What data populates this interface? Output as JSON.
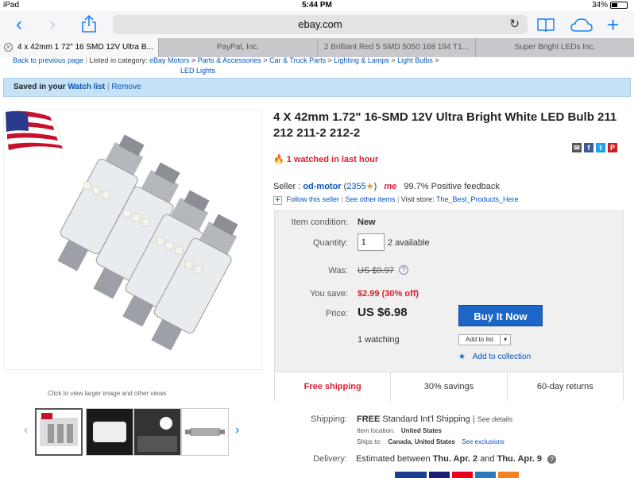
{
  "status_bar": {
    "device": "iPad",
    "time": "5:44 PM",
    "battery": "34%"
  },
  "toolbar": {
    "url": "ebay.com"
  },
  "tabs": [
    {
      "label": "4 x 42mm 1 72\" 16 SMD 12V Ultra B..."
    },
    {
      "label": "PayPal, Inc."
    },
    {
      "label": "2 Brilliant Red 5 SMD 5050 168 194 T1..."
    },
    {
      "label": "Super Bright LEDs Inc."
    }
  ],
  "breadcrumb": {
    "back": "Back to previous page",
    "listed_in": "Listed in category:",
    "items": [
      "eBay Motors",
      "Parts & Accessories",
      "Car & Truck Parts",
      "Lighting & Lamps",
      "Light Bulbs",
      "LED Lights"
    ]
  },
  "banner": {
    "prefix": "Saved in your",
    "link": "Watch list",
    "remove": "Remove"
  },
  "gallery": {
    "hint": "Click to view larger image and other views"
  },
  "listing": {
    "title": "4 X 42mm 1.72\" 16-SMD 12V Ultra Bright White LED Bulb 211 212 211-2 212-2",
    "watched": "1 watched in last hour"
  },
  "seller": {
    "label": "Seller :",
    "name": "od-motor",
    "count": "2355",
    "me_badge": "me",
    "feedback": "99.7% Positive feedback",
    "follow": "Follow this seller",
    "see_other": "See other items",
    "visit_label": "Visit store:",
    "store": "The_Best_Products_Here"
  },
  "buybox": {
    "condition_label": "Item condition:",
    "condition": "New",
    "quantity_label": "Quantity:",
    "quantity": "1",
    "available": "2 available",
    "was_label": "Was:",
    "was": "US $9.97",
    "save_label": "You save:",
    "save": "$2.99 (30% off)",
    "price_label": "Price:",
    "price": "US $6.98",
    "buy_label": "Buy It Now",
    "watching": "1 watching",
    "add_list": "Add to list",
    "add_collection": "Add to collection",
    "strip": [
      "Free shipping",
      "30% savings",
      "60-day returns"
    ]
  },
  "shipping": {
    "label": "Shipping:",
    "free": "FREE",
    "method": "Standard Int'l Shipping",
    "details": "See details",
    "location_label": "Item location:",
    "location": "United States",
    "ships_label": "Ships to:",
    "ships_to": "Canada, United States",
    "exclusions": "See exclusions"
  },
  "delivery": {
    "label": "Delivery:",
    "text": "Estimated between",
    "start": "Thu. Apr. 2",
    "and": "and",
    "end": "Thu. Apr. 9"
  },
  "colors": {
    "accent": "#1c66c7",
    "link": "#0654ba",
    "alert": "#dd1e31",
    "banner": "#c5e2f7"
  }
}
